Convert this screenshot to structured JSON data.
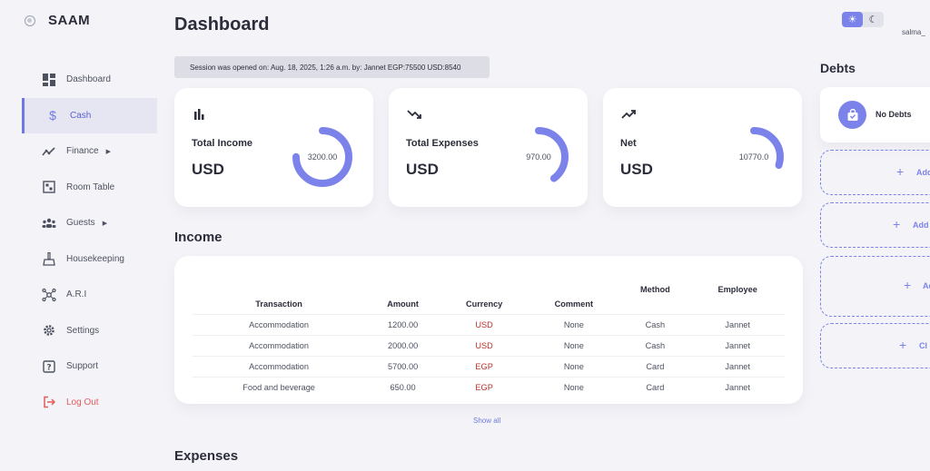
{
  "brand": {
    "name": "SAAM"
  },
  "sidebar": {
    "items": [
      {
        "label": "Dashboard",
        "icon": "dashboard-icon"
      },
      {
        "label": "Cash",
        "icon": "dollar-icon"
      },
      {
        "label": "Finance",
        "icon": "chart-line-icon"
      },
      {
        "label": "Room Table",
        "icon": "room-icon"
      },
      {
        "label": "Guests",
        "icon": "guests-icon"
      },
      {
        "label": "Housekeeping",
        "icon": "broom-icon"
      },
      {
        "label": "A.R.I",
        "icon": "network-icon"
      },
      {
        "label": "Settings",
        "icon": "gear-icon"
      },
      {
        "label": "Support",
        "icon": "help-icon"
      },
      {
        "label": "Log Out",
        "icon": "logout-icon"
      }
    ]
  },
  "header": {
    "title": "Dashboard",
    "username": "salma_",
    "session": "Session was opened on: Aug. 18, 2025, 1:26 a.m. by: Jannet EGP:75500 USD:8540"
  },
  "stats": {
    "income": {
      "label": "Total Income",
      "currency": "USD",
      "value": "3200.00",
      "fill": 0.75
    },
    "expenses": {
      "label": "Total Expenses",
      "currency": "USD",
      "value": "970.00",
      "fill": 0.4
    },
    "net": {
      "label": "Net",
      "currency": "USD",
      "value": "10770.0",
      "fill": 0.3
    }
  },
  "income": {
    "title": "Income",
    "columns": [
      "Transaction",
      "Amount",
      "Currency",
      "Comment",
      "Method",
      "Employee"
    ],
    "rows": [
      [
        "Accommodation",
        "1200.00",
        "USD",
        "None",
        "Cash",
        "Jannet"
      ],
      [
        "Accommodation",
        "2000.00",
        "USD",
        "None",
        "Cash",
        "Jannet"
      ],
      [
        "Accommodation",
        "5700.00",
        "EGP",
        "None",
        "Card",
        "Jannet"
      ],
      [
        "Food and beverage",
        "650.00",
        "EGP",
        "None",
        "Card",
        "Jannet"
      ]
    ],
    "show_all": "Show all"
  },
  "expenses": {
    "title": "Expenses"
  },
  "debts": {
    "title": "Debts",
    "empty_label": "No Debts",
    "add_labels": [
      "Add",
      "Add",
      "Ad",
      "Cl"
    ]
  },
  "colors": {
    "accent": "#7b83eb",
    "danger": "#e45b5b",
    "currency": "#b8322b"
  }
}
